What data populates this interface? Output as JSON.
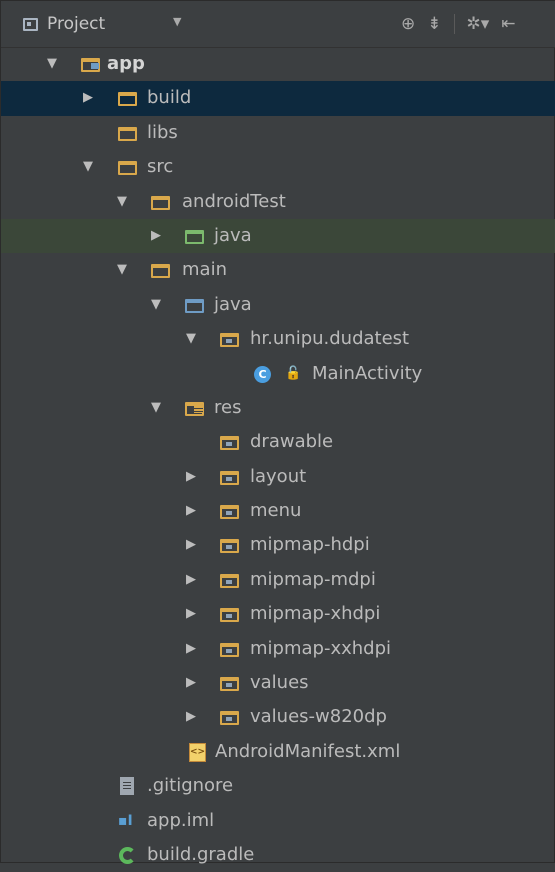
{
  "toolbar": {
    "title": "Project",
    "dropdown_glyph": "▼",
    "icons": [
      "target-icon",
      "collapse-icon",
      "settings-icon",
      "hide-icon"
    ]
  },
  "colors": {
    "background": "#3c3f41",
    "selected_row": "#0d293e",
    "highlight_row": "#3b4739",
    "folder": "#d9a84b",
    "source_folder": "#6f9cc5",
    "test_folder": "#7cb96d"
  },
  "tree": [
    {
      "label": "app",
      "bold": true,
      "expanded": true,
      "icon": "module-folder-icon"
    },
    {
      "label": "build",
      "expanded": false,
      "icon": "folder-icon",
      "selected": true
    },
    {
      "label": "libs",
      "icon": "folder-icon"
    },
    {
      "label": "src",
      "expanded": true,
      "icon": "folder-icon"
    },
    {
      "label": "androidTest",
      "expanded": true,
      "icon": "folder-icon"
    },
    {
      "label": "java",
      "expanded": false,
      "icon": "test-source-folder-icon",
      "highlighted": true
    },
    {
      "label": "main",
      "expanded": true,
      "icon": "folder-icon"
    },
    {
      "label": "java",
      "expanded": true,
      "icon": "source-folder-icon"
    },
    {
      "label": "hr.unipu.dudatest",
      "expanded": true,
      "icon": "package-icon"
    },
    {
      "label": "MainActivity",
      "icon": "class-icon",
      "class_letter": "C"
    },
    {
      "label": "res",
      "expanded": true,
      "icon": "resource-folder-icon"
    },
    {
      "label": "drawable",
      "icon": "package-icon"
    },
    {
      "label": "layout",
      "expanded": false,
      "icon": "package-icon"
    },
    {
      "label": "menu",
      "expanded": false,
      "icon": "package-icon"
    },
    {
      "label": "mipmap-hdpi",
      "expanded": false,
      "icon": "package-icon"
    },
    {
      "label": "mipmap-mdpi",
      "expanded": false,
      "icon": "package-icon"
    },
    {
      "label": "mipmap-xhdpi",
      "expanded": false,
      "icon": "package-icon"
    },
    {
      "label": "mipmap-xxhdpi",
      "expanded": false,
      "icon": "package-icon"
    },
    {
      "label": "values",
      "expanded": false,
      "icon": "package-icon"
    },
    {
      "label": "values-w820dp",
      "expanded": false,
      "icon": "package-icon"
    },
    {
      "label": "AndroidManifest.xml",
      "icon": "xml-file-icon"
    },
    {
      "label": ".gitignore",
      "icon": "text-file-icon"
    },
    {
      "label": "app.iml",
      "icon": "iml-file-icon"
    },
    {
      "label": "build.gradle",
      "icon": "gradle-icon"
    }
  ]
}
